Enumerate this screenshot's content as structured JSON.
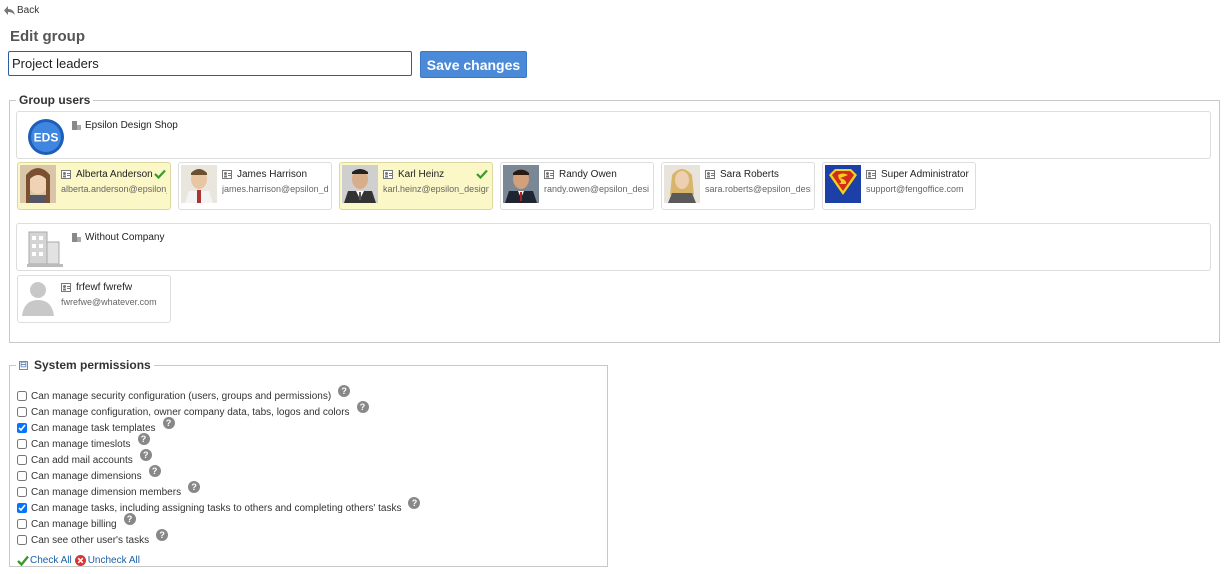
{
  "nav": {
    "back_label": "Back"
  },
  "page": {
    "title": "Edit group"
  },
  "form": {
    "group_name_value": "Project leaders",
    "save_label": "Save changes"
  },
  "group_users": {
    "legend": "Group users",
    "companies": [
      {
        "name": "Epsilon Design Shop",
        "logo_text": "EDS",
        "users": [
          {
            "name": "Alberta Anderson",
            "email": "alberta.anderson@epsilon_",
            "selected": true
          },
          {
            "name": "James Harrison",
            "email": "james.harrison@epsilon_d",
            "selected": false
          },
          {
            "name": "Karl Heinz",
            "email": "karl.heinz@epsilon_design",
            "selected": true
          },
          {
            "name": "Randy Owen",
            "email": "randy.owen@epsilon_desi",
            "selected": false
          },
          {
            "name": "Sara Roberts",
            "email": "sara.roberts@epsilon_desi",
            "selected": false
          },
          {
            "name": "Super Administrator",
            "email": "support@fengoffice.com",
            "selected": false
          }
        ]
      },
      {
        "name": "Without Company",
        "users": [
          {
            "name": "frfewf fwrefw",
            "email": "fwrefwe@whatever.com",
            "selected": false
          }
        ]
      }
    ]
  },
  "system_permissions": {
    "legend": "System permissions",
    "toggle_symbol": "⊟",
    "items": [
      {
        "label": "Can manage security configuration (users, groups and permissions)",
        "checked": false
      },
      {
        "label": "Can manage configuration, owner company data, tabs, logos and colors",
        "checked": false
      },
      {
        "label": "Can manage task templates",
        "checked": true
      },
      {
        "label": "Can manage timeslots",
        "checked": false
      },
      {
        "label": "Can add mail accounts",
        "checked": false
      },
      {
        "label": "Can manage dimensions",
        "checked": false
      },
      {
        "label": "Can manage dimension members",
        "checked": false
      },
      {
        "label": "Can manage tasks, including assigning tasks to others and completing others' tasks",
        "checked": true
      },
      {
        "label": "Can manage billing",
        "checked": false
      },
      {
        "label": "Can see other user's tasks",
        "checked": false
      }
    ],
    "help_symbol": "?",
    "check_all_label": "Check All",
    "uncheck_all_label": "Uncheck All"
  },
  "colors": {
    "save_button": "#4a8ad8",
    "selected_user_bg": "#fbf7c6",
    "check_green": "#3a9a2a",
    "uncheck_red": "#d33",
    "link_blue": "#1b5fa8"
  },
  "icons": {
    "back": "back-arrow-icon",
    "company": "building-icon",
    "user_card": "vcard-icon",
    "selected": "check-icon",
    "help": "help-icon",
    "check_all": "check-all-icon",
    "uncheck_all": "uncheck-all-icon"
  }
}
